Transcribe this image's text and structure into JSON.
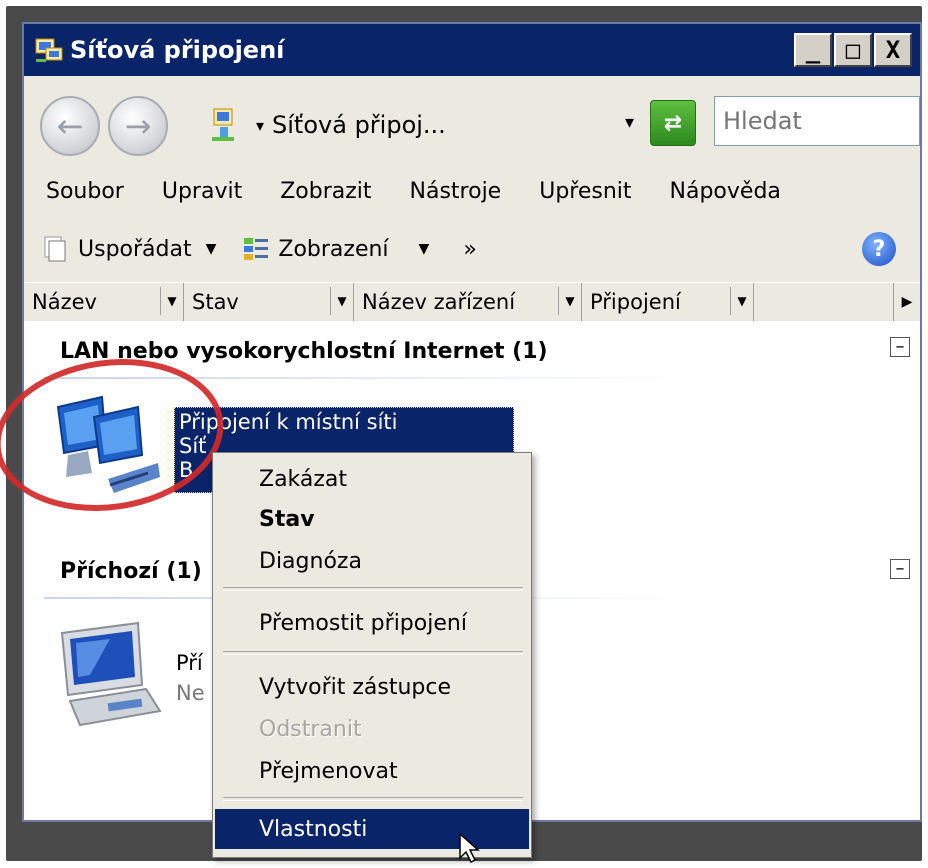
{
  "window": {
    "title": "Síťová připojení",
    "controls": {
      "minimize": "_",
      "maximize": "□",
      "close": "X"
    }
  },
  "navbar": {
    "back_icon": "back-arrow-icon",
    "forward_icon": "forward-arrow-icon",
    "address_text": "Síťová připoj...",
    "address_arrow": "▾",
    "address_dropdown": "▾",
    "search_placeholder": "Hledat"
  },
  "menu": [
    "Soubor",
    "Upravit",
    "Zobrazit",
    "Nástroje",
    "Upřesnit",
    "Nápověda"
  ],
  "toolbar": {
    "organize_label": "Uspořádat",
    "views_label": "Zobrazení",
    "more_label": "»",
    "help_label": "?"
  },
  "columns": [
    "Název",
    "Stav",
    "Název zařízení",
    "Připojení"
  ],
  "groups": [
    {
      "title": "LAN nebo vysokorychlostní Internet (1)",
      "collapse_symbol": "⊟",
      "item": {
        "name": "Připojení k místní síti",
        "line2": "Síť",
        "line3": "B"
      }
    },
    {
      "title": "Příchozí (1)",
      "collapse_symbol": "⊟",
      "item": {
        "name": "Pří",
        "line2": "Ne"
      }
    }
  ],
  "context_menu": {
    "items": [
      {
        "label": "Zakázat",
        "style": "normal"
      },
      {
        "label": "Stav",
        "style": "bold"
      },
      {
        "label": "Diagnóza",
        "style": "normal"
      },
      {
        "label": "Přemostit připojení",
        "style": "normal"
      },
      {
        "label": "Vytvořit zástupce",
        "style": "normal"
      },
      {
        "label": "Odstranit",
        "style": "disabled"
      },
      {
        "label": "Přejmenovat",
        "style": "normal"
      },
      {
        "label": "Vlastnosti",
        "style": "highlighted"
      }
    ]
  },
  "colors": {
    "titlebar": "#0a246a",
    "chrome": "#ece9e0",
    "selection": "#0a246a",
    "annotation": "#d12a2a"
  }
}
